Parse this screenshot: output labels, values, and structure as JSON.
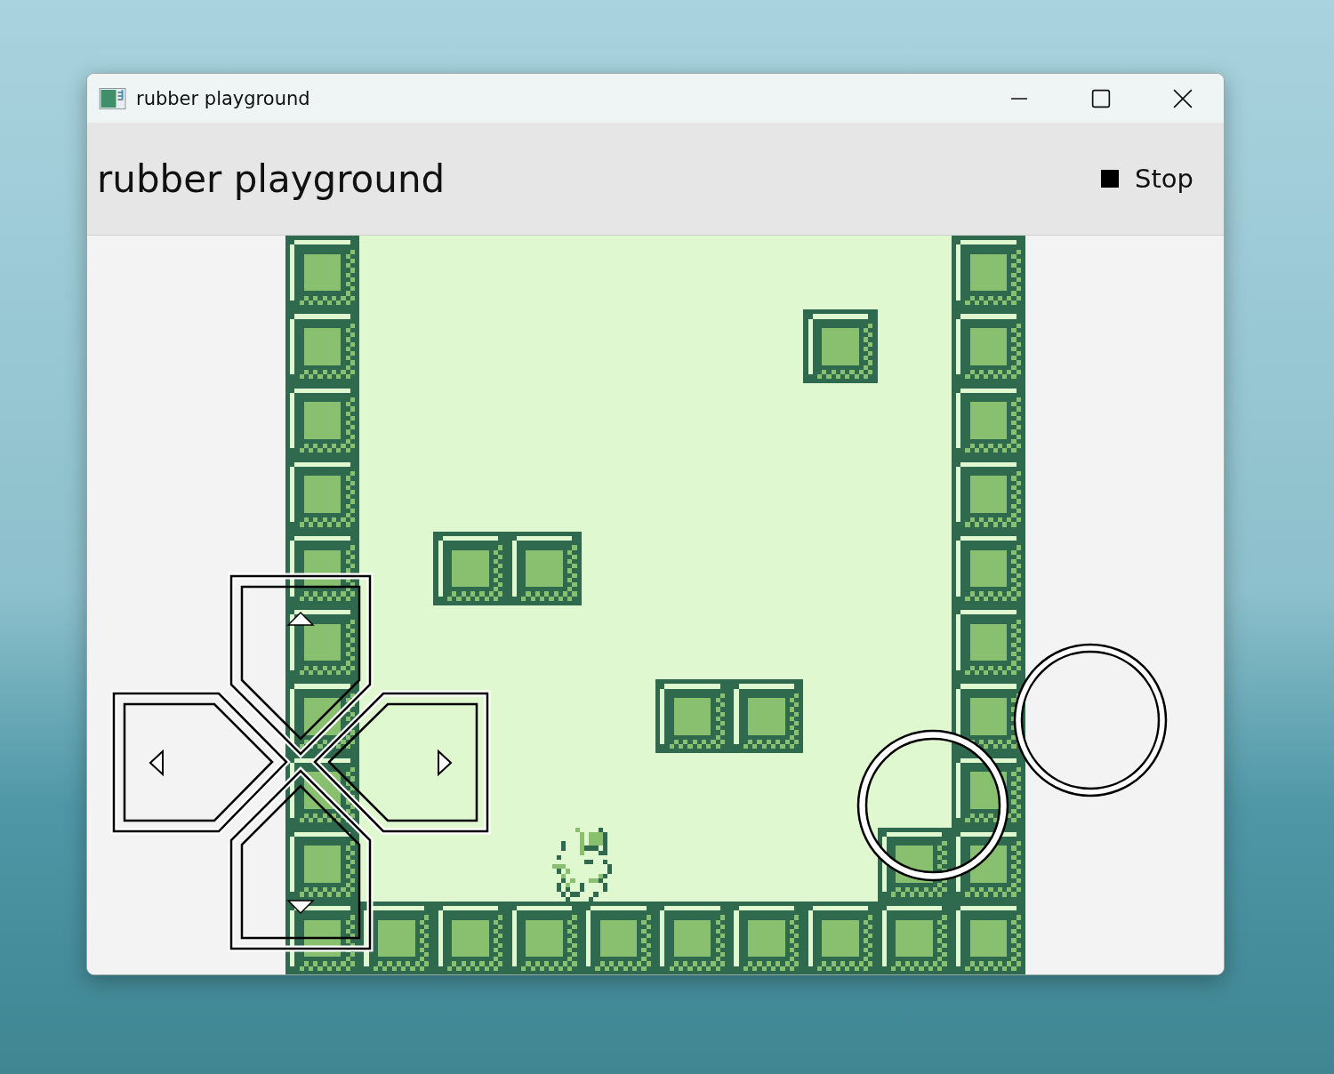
{
  "window": {
    "title": "rubber playground"
  },
  "header": {
    "title": "rubber playground",
    "stop_button": {
      "label": "Stop"
    }
  }
}
